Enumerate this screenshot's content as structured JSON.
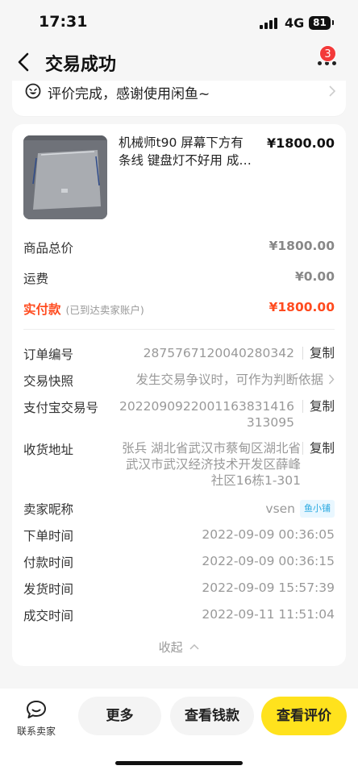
{
  "status_bar": {
    "time": "17:31",
    "network": "4G",
    "battery": "81"
  },
  "header": {
    "title": "交易成功",
    "badge_count": "3"
  },
  "review_banner": {
    "text": "评价完成，感谢使用闲鱼~"
  },
  "item": {
    "title_line1": "机械师t90 屏幕下方有",
    "title_line2": "条线 键盘灯不好用 成…",
    "price": "¥1800.00"
  },
  "summary": {
    "total_label": "商品总价",
    "total_value": "¥1800.00",
    "shipping_label": "运费",
    "shipping_value": "¥0.00",
    "paid_label": "实付款",
    "paid_note": "(已到达卖家账户)",
    "paid_value": "¥1800.00"
  },
  "details": {
    "order_no_label": "订单编号",
    "order_no": "2875767120040280342",
    "snapshot_label": "交易快照",
    "snapshot_value": "发生交易争议时，可作为判断依据",
    "alipay_label": "支付宝交易号",
    "alipay_line1": "2022090922001163831416",
    "alipay_line2": "313095",
    "address_label": "收货地址",
    "address_line1": "张兵  湖北省武汉市蔡甸区湖北省",
    "address_line2": "武汉市武汉经济技术开发区薛峰",
    "address_line3": "社区16栋1-301",
    "seller_label": "卖家昵称",
    "seller_name": "vsen",
    "seller_tag": "鱼小铺",
    "order_time_label": "下单时间",
    "order_time": "2022-09-09 00:36:05",
    "pay_time_label": "付款时间",
    "pay_time": "2022-09-09 00:36:15",
    "ship_time_label": "发货时间",
    "ship_time": "2022-09-09 15:57:39",
    "deal_time_label": "成交时间",
    "deal_time": "2022-09-11 11:51:04",
    "copy_label": "复制",
    "collapse_label": "收起"
  },
  "bottom_bar": {
    "contact_label": "联系卖家",
    "more_label": "更多",
    "money_label": "查看钱款",
    "review_label": "查看评价"
  },
  "colors": {
    "accent_yellow": "#ffe21d",
    "price_red": "#ff4b1f",
    "badge_red": "#f33a3a"
  }
}
